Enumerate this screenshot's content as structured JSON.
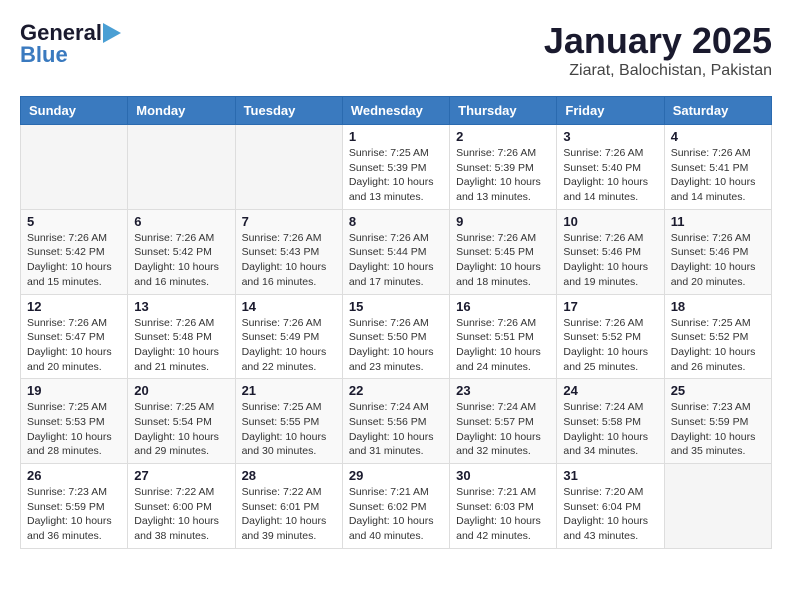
{
  "header": {
    "logo_general": "General",
    "logo_blue": "Blue",
    "month_title": "January 2025",
    "location": "Ziarat, Balochistan, Pakistan"
  },
  "days_of_week": [
    "Sunday",
    "Monday",
    "Tuesday",
    "Wednesday",
    "Thursday",
    "Friday",
    "Saturday"
  ],
  "weeks": [
    [
      {
        "day": "",
        "info": ""
      },
      {
        "day": "",
        "info": ""
      },
      {
        "day": "",
        "info": ""
      },
      {
        "day": "1",
        "info": "Sunrise: 7:25 AM\nSunset: 5:39 PM\nDaylight: 10 hours\nand 13 minutes."
      },
      {
        "day": "2",
        "info": "Sunrise: 7:26 AM\nSunset: 5:39 PM\nDaylight: 10 hours\nand 13 minutes."
      },
      {
        "day": "3",
        "info": "Sunrise: 7:26 AM\nSunset: 5:40 PM\nDaylight: 10 hours\nand 14 minutes."
      },
      {
        "day": "4",
        "info": "Sunrise: 7:26 AM\nSunset: 5:41 PM\nDaylight: 10 hours\nand 14 minutes."
      }
    ],
    [
      {
        "day": "5",
        "info": "Sunrise: 7:26 AM\nSunset: 5:42 PM\nDaylight: 10 hours\nand 15 minutes."
      },
      {
        "day": "6",
        "info": "Sunrise: 7:26 AM\nSunset: 5:42 PM\nDaylight: 10 hours\nand 16 minutes."
      },
      {
        "day": "7",
        "info": "Sunrise: 7:26 AM\nSunset: 5:43 PM\nDaylight: 10 hours\nand 16 minutes."
      },
      {
        "day": "8",
        "info": "Sunrise: 7:26 AM\nSunset: 5:44 PM\nDaylight: 10 hours\nand 17 minutes."
      },
      {
        "day": "9",
        "info": "Sunrise: 7:26 AM\nSunset: 5:45 PM\nDaylight: 10 hours\nand 18 minutes."
      },
      {
        "day": "10",
        "info": "Sunrise: 7:26 AM\nSunset: 5:46 PM\nDaylight: 10 hours\nand 19 minutes."
      },
      {
        "day": "11",
        "info": "Sunrise: 7:26 AM\nSunset: 5:46 PM\nDaylight: 10 hours\nand 20 minutes."
      }
    ],
    [
      {
        "day": "12",
        "info": "Sunrise: 7:26 AM\nSunset: 5:47 PM\nDaylight: 10 hours\nand 20 minutes."
      },
      {
        "day": "13",
        "info": "Sunrise: 7:26 AM\nSunset: 5:48 PM\nDaylight: 10 hours\nand 21 minutes."
      },
      {
        "day": "14",
        "info": "Sunrise: 7:26 AM\nSunset: 5:49 PM\nDaylight: 10 hours\nand 22 minutes."
      },
      {
        "day": "15",
        "info": "Sunrise: 7:26 AM\nSunset: 5:50 PM\nDaylight: 10 hours\nand 23 minutes."
      },
      {
        "day": "16",
        "info": "Sunrise: 7:26 AM\nSunset: 5:51 PM\nDaylight: 10 hours\nand 24 minutes."
      },
      {
        "day": "17",
        "info": "Sunrise: 7:26 AM\nSunset: 5:52 PM\nDaylight: 10 hours\nand 25 minutes."
      },
      {
        "day": "18",
        "info": "Sunrise: 7:25 AM\nSunset: 5:52 PM\nDaylight: 10 hours\nand 26 minutes."
      }
    ],
    [
      {
        "day": "19",
        "info": "Sunrise: 7:25 AM\nSunset: 5:53 PM\nDaylight: 10 hours\nand 28 minutes."
      },
      {
        "day": "20",
        "info": "Sunrise: 7:25 AM\nSunset: 5:54 PM\nDaylight: 10 hours\nand 29 minutes."
      },
      {
        "day": "21",
        "info": "Sunrise: 7:25 AM\nSunset: 5:55 PM\nDaylight: 10 hours\nand 30 minutes."
      },
      {
        "day": "22",
        "info": "Sunrise: 7:24 AM\nSunset: 5:56 PM\nDaylight: 10 hours\nand 31 minutes."
      },
      {
        "day": "23",
        "info": "Sunrise: 7:24 AM\nSunset: 5:57 PM\nDaylight: 10 hours\nand 32 minutes."
      },
      {
        "day": "24",
        "info": "Sunrise: 7:24 AM\nSunset: 5:58 PM\nDaylight: 10 hours\nand 34 minutes."
      },
      {
        "day": "25",
        "info": "Sunrise: 7:23 AM\nSunset: 5:59 PM\nDaylight: 10 hours\nand 35 minutes."
      }
    ],
    [
      {
        "day": "26",
        "info": "Sunrise: 7:23 AM\nSunset: 5:59 PM\nDaylight: 10 hours\nand 36 minutes."
      },
      {
        "day": "27",
        "info": "Sunrise: 7:22 AM\nSunset: 6:00 PM\nDaylight: 10 hours\nand 38 minutes."
      },
      {
        "day": "28",
        "info": "Sunrise: 7:22 AM\nSunset: 6:01 PM\nDaylight: 10 hours\nand 39 minutes."
      },
      {
        "day": "29",
        "info": "Sunrise: 7:21 AM\nSunset: 6:02 PM\nDaylight: 10 hours\nand 40 minutes."
      },
      {
        "day": "30",
        "info": "Sunrise: 7:21 AM\nSunset: 6:03 PM\nDaylight: 10 hours\nand 42 minutes."
      },
      {
        "day": "31",
        "info": "Sunrise: 7:20 AM\nSunset: 6:04 PM\nDaylight: 10 hours\nand 43 minutes."
      },
      {
        "day": "",
        "info": ""
      }
    ]
  ]
}
